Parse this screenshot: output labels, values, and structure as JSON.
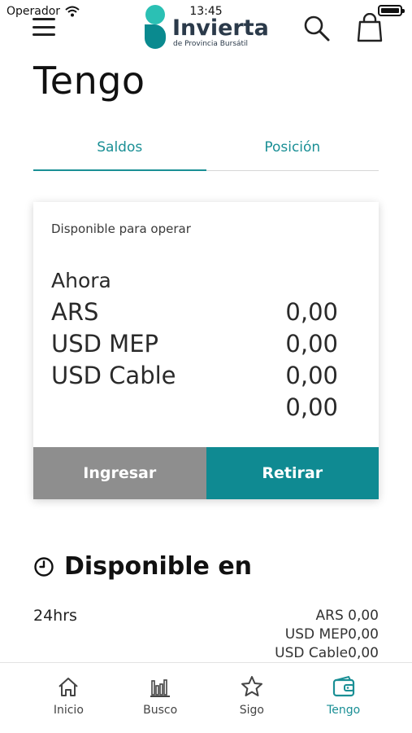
{
  "status_bar": {
    "carrier": "Operador",
    "time": "13:45"
  },
  "header": {
    "logo_name": "Invierta",
    "logo_sub": "de Provincia Bursátil"
  },
  "page": {
    "title": "Tengo"
  },
  "tabs": [
    {
      "label": "Saldos",
      "active": true
    },
    {
      "label": "Posición",
      "active": false
    }
  ],
  "card": {
    "caption": "Disponible para operar",
    "now_label": "Ahora",
    "balances": [
      {
        "currency": "ARS",
        "amount": "0,00"
      },
      {
        "currency": "USD MEP",
        "amount": "0,00"
      },
      {
        "currency": "USD Cable",
        "amount": "0,00"
      },
      {
        "currency": "",
        "amount": "0,00"
      }
    ],
    "deposit_label": "Ingresar",
    "withdraw_label": "Retirar"
  },
  "available_in": {
    "title": "Disponible en",
    "rows": [
      {
        "period": "24hrs",
        "values": [
          "ARS 0,00",
          "USD MEP0,00",
          "USD Cable0,00"
        ]
      }
    ]
  },
  "bottom_nav": [
    {
      "label": "Inicio",
      "icon": "home-icon",
      "active": false
    },
    {
      "label": "Busco",
      "icon": "bar-chart-icon",
      "active": false
    },
    {
      "label": "Sigo",
      "icon": "star-icon",
      "active": false
    },
    {
      "label": "Tengo",
      "icon": "wallet-icon",
      "active": true
    }
  ],
  "colors": {
    "accent": "#1a8f95",
    "button_grey": "#8e8e8e",
    "button_teal": "#0f8a92",
    "logo_light": "#2bc0b4",
    "logo_dark": "#0a8a8f"
  }
}
